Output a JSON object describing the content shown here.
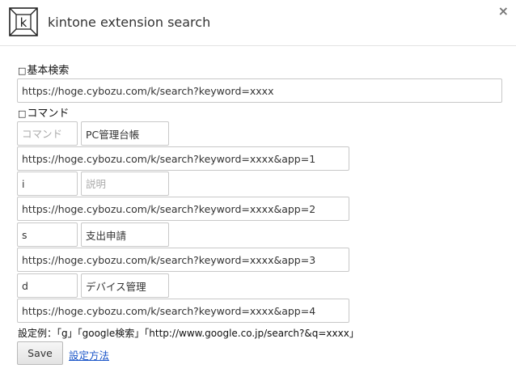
{
  "header": {
    "logo_letter": "k",
    "title": "kintone extension search",
    "close_label": "×"
  },
  "basic": {
    "mark": "□",
    "label": "基本検索",
    "url": "https://hoge.cybozu.com/k/search?keyword=xxxx"
  },
  "commands": {
    "mark": "□",
    "label": "コマンド",
    "items": [
      {
        "command": "",
        "command_placeholder": "コマンド",
        "name": "PC管理台帳",
        "name_placeholder": "",
        "url": "https://hoge.cybozu.com/k/search?keyword=xxxx&app=1"
      },
      {
        "command": "i",
        "command_placeholder": "",
        "name": "",
        "name_placeholder": "説明",
        "url": "https://hoge.cybozu.com/k/search?keyword=xxxx&app=2"
      },
      {
        "command": "s",
        "command_placeholder": "",
        "name": "支出申請",
        "name_placeholder": "",
        "url": "https://hoge.cybozu.com/k/search?keyword=xxxx&app=3"
      },
      {
        "command": "d",
        "command_placeholder": "",
        "name": "デバイス管理",
        "name_placeholder": "",
        "url": "https://hoge.cybozu.com/k/search?keyword=xxxx&app=4"
      }
    ]
  },
  "example_text": "設定例：「g」「google検索」「http://www.google.co.jp/search?&q=xxxx」",
  "save_label": "Save",
  "howto_label": "設定方法"
}
